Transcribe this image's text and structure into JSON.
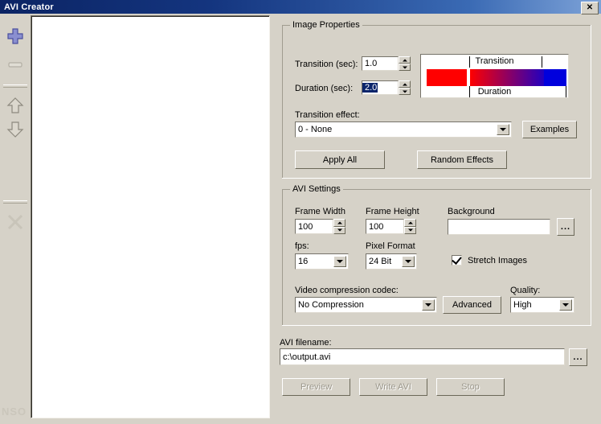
{
  "window": {
    "title": "AVI Creator",
    "close_label": "✕"
  },
  "toolbar": {
    "items": [
      {
        "name": "add-image-button",
        "icon": "plus-icon",
        "enabled": true
      },
      {
        "name": "remove-image-button",
        "icon": "minus-icon",
        "enabled": false
      },
      {
        "name": "move-up-button",
        "icon": "arrow-up-icon",
        "enabled": true
      },
      {
        "name": "move-down-button",
        "icon": "arrow-down-icon",
        "enabled": true
      },
      {
        "name": "clear-all-button",
        "icon": "close-x-icon",
        "enabled": false
      }
    ]
  },
  "image_list": {
    "items": [],
    "watermark": "NSO"
  },
  "image_properties": {
    "group_title": "Image Properties",
    "transition_label": "Transition (sec):",
    "transition_value": "1.0",
    "duration_label": "Duration (sec):",
    "duration_value": "2.0",
    "preview": {
      "top_label": "Transition",
      "bottom_label": "Duration",
      "start_color": "#ff0000",
      "end_color": "#0000dd"
    },
    "transition_effect_label": "Transition effect:",
    "transition_effect_value": "0 - None",
    "examples_label": "Examples",
    "apply_all_label": "Apply All",
    "random_effects_label": "Random Effects"
  },
  "avi_settings": {
    "group_title": "AVI Settings",
    "frame_width_label": "Frame Width",
    "frame_width_value": "100",
    "frame_height_label": "Frame Height",
    "frame_height_value": "100",
    "background_label": "Background",
    "background_value": "",
    "background_browse_label": "...",
    "fps_label": "fps:",
    "fps_value": "16",
    "pixel_format_label": "Pixel Format",
    "pixel_format_value": "24 Bit",
    "stretch_images_label": "Stretch Images",
    "stretch_images_checked": true,
    "codec_label": "Video compression codec:",
    "codec_value": "No Compression",
    "advanced_label": "Advanced",
    "quality_label": "Quality:",
    "quality_value": "High"
  },
  "output": {
    "filename_label": "AVI filename:",
    "filename_value": "c:\\output.avi",
    "browse_label": "..."
  },
  "actions": {
    "preview_label": "Preview",
    "write_avi_label": "Write AVI",
    "stop_label": "Stop"
  }
}
